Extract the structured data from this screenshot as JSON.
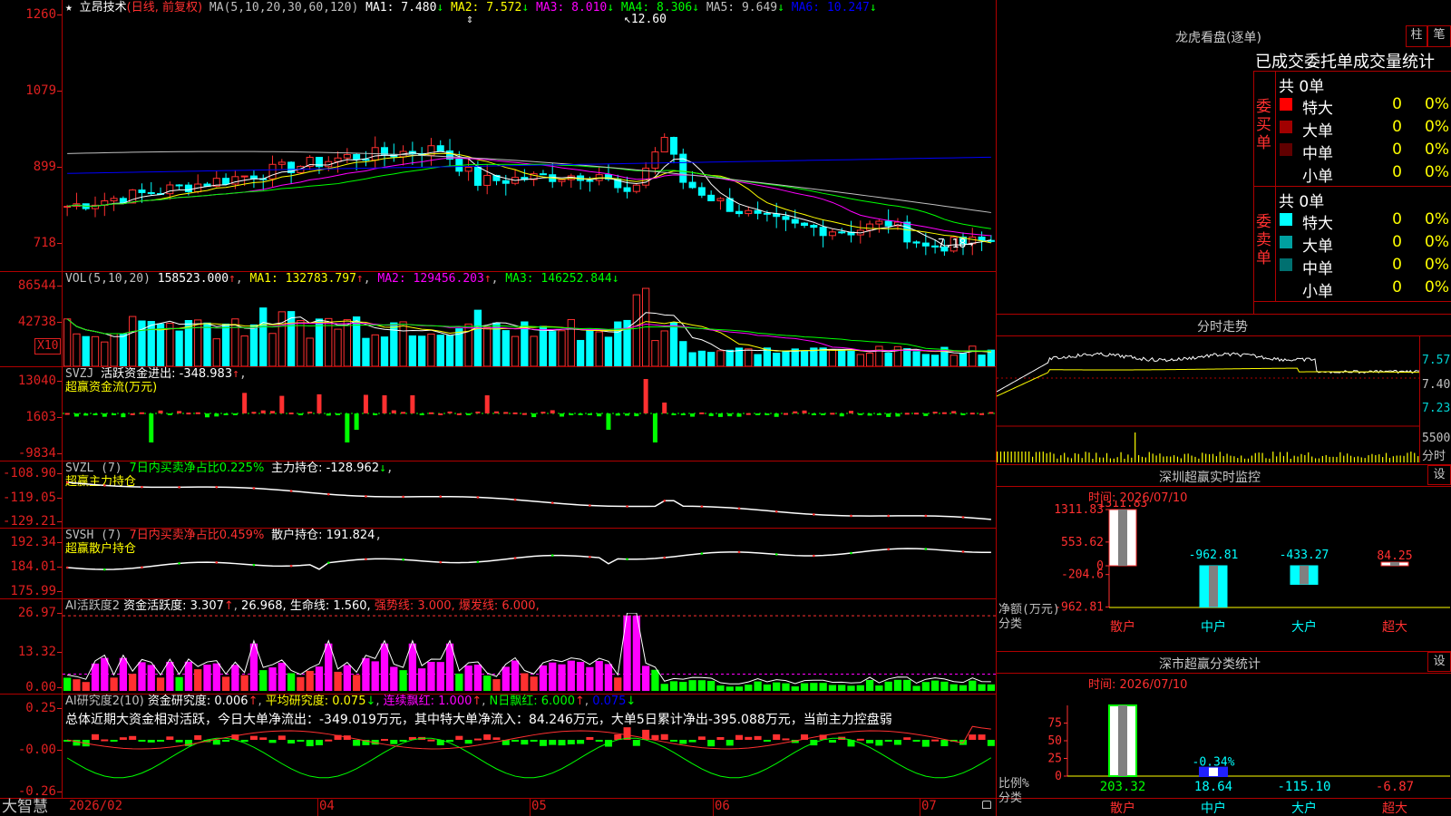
{
  "stock": {
    "star": "★",
    "name": "立昂技术",
    "mode": "(日线, 前复权)",
    "ma_prefix": "MA(5,10,20,30,60,120)",
    "ma": [
      {
        "label": "MA1:",
        "value": "7.480",
        "arrow": "↓",
        "color": "#ffffff"
      },
      {
        "label": "MA2:",
        "value": "7.572",
        "arrow": "↓",
        "color": "#ffff00"
      },
      {
        "label": "MA3:",
        "value": "8.010",
        "arrow": "↓",
        "color": "#ff00ff"
      },
      {
        "label": "MA4:",
        "value": "8.306",
        "arrow": "↓",
        "color": "#00ff00"
      },
      {
        "label": "MA5:",
        "value": "9.649",
        "arrow": "↓",
        "color": "#c0c0c0"
      },
      {
        "label": "MA6:",
        "value": "10.247",
        "arrow": "↓",
        "color": "#0000ff"
      }
    ],
    "high_mark": "12.60",
    "low_mark": "7.18",
    "y_ticks": [
      "1260",
      "1079",
      "899",
      "718"
    ]
  },
  "vol": {
    "header": "VOL(5,10,20)",
    "value": "158523.000",
    "ma1": "MA1: 132783.797",
    "ma2": "MA2: 129456.203",
    "ma3": "MA3: 146252.844",
    "y_ticks": [
      "86544",
      "42738"
    ],
    "unit": "X10"
  },
  "svzj": {
    "header": "SVZJ",
    "line1": "活跃资金进出: -348.983",
    "line2": "超赢资金流(万元)",
    "y_ticks": [
      "13040",
      "1603",
      "-9834"
    ]
  },
  "svzl": {
    "header": "SVZL (7)",
    "ratio": "7日内买卖净占比0.225%",
    "hold": "主力持仓: -128.962",
    "title": "超赢主力持仓",
    "y_ticks": [
      "-108.90",
      "-119.05",
      "-129.21"
    ]
  },
  "svsh": {
    "header": "SVSH (7)",
    "ratio": "7日内买卖净占比0.459%",
    "hold": "散户持仓: 191.824",
    "title": "超赢散户持仓",
    "y_ticks": [
      "192.34",
      "184.01",
      "175.99"
    ]
  },
  "ai1": {
    "header": "AI活跃度2",
    "a": "资金活跃度: 3.307",
    "b": "26.968,",
    "c": "生命线: 1.560,",
    "d": "强势线: 3.000,",
    "e": "爆发线: 6.000,",
    "y_ticks": [
      "26.97",
      "13.32",
      "0.00"
    ]
  },
  "ai2": {
    "header": "AI研究度2(10)",
    "a": "资金研究度: 0.006",
    "b": "平均研究度: 0.075",
    "c": "连续飘红: 1.000",
    "d": "N日飘红: 6.000",
    "e": "0.075",
    "summary": "总体近期大资金相对活跃，今日大单净流出：-349.019万元，其中特大单净流入：84.246万元，大单5日累计净出-395.088万元，当前主力控盘弱",
    "y_ticks": [
      "0.25",
      "-0.00",
      "-0.26"
    ]
  },
  "bottom": {
    "brand": "大智慧",
    "dates": [
      "2026/02",
      "04",
      "05",
      "06",
      "07"
    ]
  },
  "right": {
    "title": "龙虎看盘(逐单)",
    "btn1": "柱",
    "btn2": "笔",
    "stats_title": "已成交委托单成交量统计",
    "buy_side": "委买单",
    "sell_side": "委卖单",
    "buy_total": "共 0单",
    "sell_total": "共 0单",
    "buy_rows": [
      {
        "name": "特大",
        "count": "0",
        "pct": "0%",
        "color": "#ff0000"
      },
      {
        "name": "大单",
        "count": "0",
        "pct": "0%",
        "color": "#a00000"
      },
      {
        "name": "中单",
        "count": "0",
        "pct": "0%",
        "color": "#600000"
      },
      {
        "name": "小单",
        "count": "0",
        "pct": "0%",
        "color": "#000000"
      }
    ],
    "sell_rows": [
      {
        "name": "特大",
        "count": "0",
        "pct": "0%",
        "color": "#00ffff"
      },
      {
        "name": "大单",
        "count": "0",
        "pct": "0%",
        "color": "#00a0a0"
      },
      {
        "name": "中单",
        "count": "0",
        "pct": "0%",
        "color": "#007070"
      },
      {
        "name": "小单",
        "count": "0",
        "pct": "0%",
        "color": "#000000"
      }
    ],
    "intraday_title": "分时走势",
    "intraday_ticks": [
      "7.57",
      "7.40",
      "7.23"
    ],
    "intraday_vol_tick": "5500",
    "intraday_vol_label": "分时",
    "monitor_title": "深圳超赢实时监控",
    "monitor_btn": "设",
    "monitor_time": "时间: 2026/07/10",
    "monitor_ticks": [
      "1311.83",
      "553.62",
      "0",
      "-204.6",
      "-962.81"
    ],
    "monitor_axis_label": "净额(万元)",
    "monitor_axis_label2": "分类",
    "monitor_bars": [
      {
        "cat": "散户",
        "value": 1311.83,
        "label": "1311.83"
      },
      {
        "cat": "中户",
        "value": -962.81,
        "label": "-962.81"
      },
      {
        "cat": "大户",
        "value": -433.27,
        "label": "-433.27"
      },
      {
        "cat": "超大",
        "value": 84.25,
        "label": "84.25"
      }
    ],
    "class_title": "深市超赢分类统计",
    "class_btn": "设",
    "class_time": "时间: 2026/07/10",
    "class_ticks": [
      "75",
      "50",
      "25",
      "0"
    ],
    "class_axis_label": "比例%",
    "class_axis_label2": "分类",
    "class_bars": [
      {
        "cat": "散户",
        "pct": 100,
        "value": "203.32"
      },
      {
        "cat": "中户",
        "pct": 12,
        "value": "18.64",
        "pct_label": "-0.34%"
      },
      {
        "cat": "大户",
        "pct": 0,
        "value": "-115.10"
      },
      {
        "cat": "超大",
        "pct": 0,
        "value": "-6.87"
      }
    ]
  }
}
